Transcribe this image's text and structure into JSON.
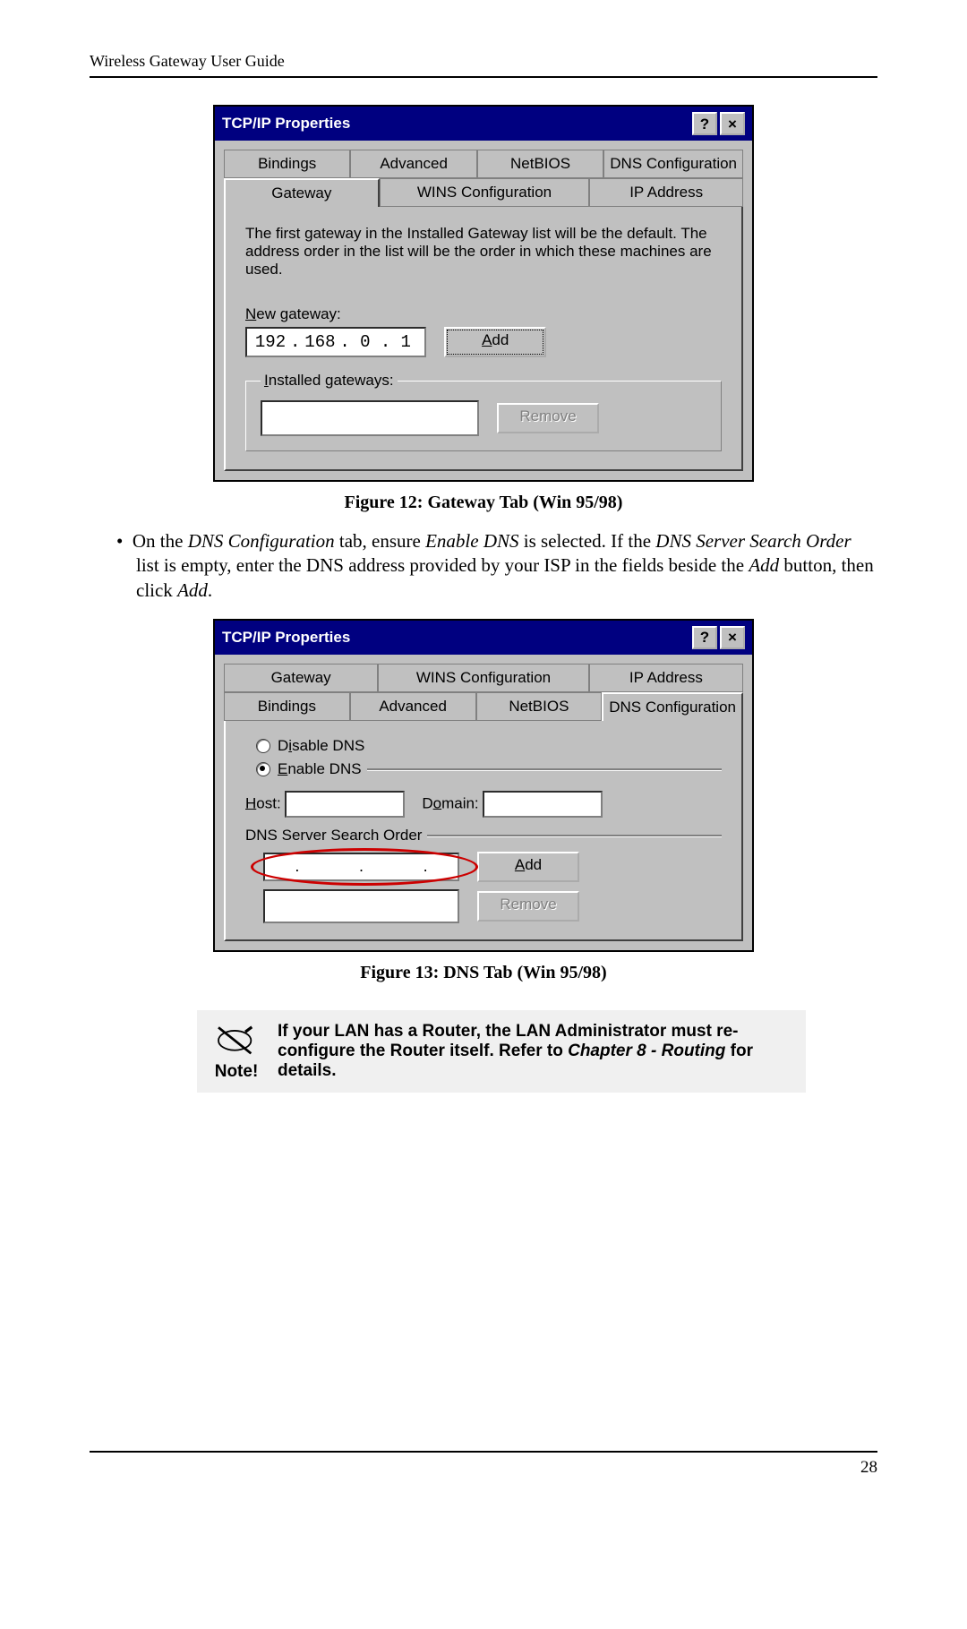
{
  "header": "Wireless Gateway User Guide",
  "page_number": "28",
  "dialog1": {
    "title": "TCP/IP Properties",
    "tabs_row1": [
      "Bindings",
      "Advanced",
      "NetBIOS",
      "DNS Configuration"
    ],
    "tabs_row2": [
      "Gateway",
      "WINS Configuration",
      "IP Address"
    ],
    "intro": "The first gateway in the Installed Gateway list will be the default. The address order in the list will be the order in which these machines are used.",
    "new_gateway_label": "New gateway:",
    "ip": [
      "192",
      "168",
      "0",
      "1"
    ],
    "add_btn": "Add",
    "installed_label": "Installed gateways:",
    "remove_btn": "Remove"
  },
  "caption1": "Figure 12: Gateway Tab (Win 95/98)",
  "para1": "On the DNS Configuration tab, ensure Enable DNS is selected. If the DNS Server Search Order list is empty, enter the DNS address provided by your ISP in the fields beside the Add button, then click Add.",
  "dialog2": {
    "title": "TCP/IP Properties",
    "tabs_row1": [
      "Gateway",
      "WINS Configuration",
      "IP Address"
    ],
    "tabs_row2": [
      "Bindings",
      "Advanced",
      "NetBIOS",
      "DNS Configuration"
    ],
    "disable": "Disable DNS",
    "enable": "Enable DNS",
    "host": "Host:",
    "domain": "Domain:",
    "search": "DNS Server Search Order",
    "add_btn": "Add",
    "remove_btn": "Remove"
  },
  "caption2": "Figure 13: DNS Tab (Win 95/98)",
  "note": {
    "label": "Note!",
    "text": "If your LAN has a Router, the LAN Administrator must re-configure the Router itself. Refer to Chapter 8 - Routing for details."
  }
}
